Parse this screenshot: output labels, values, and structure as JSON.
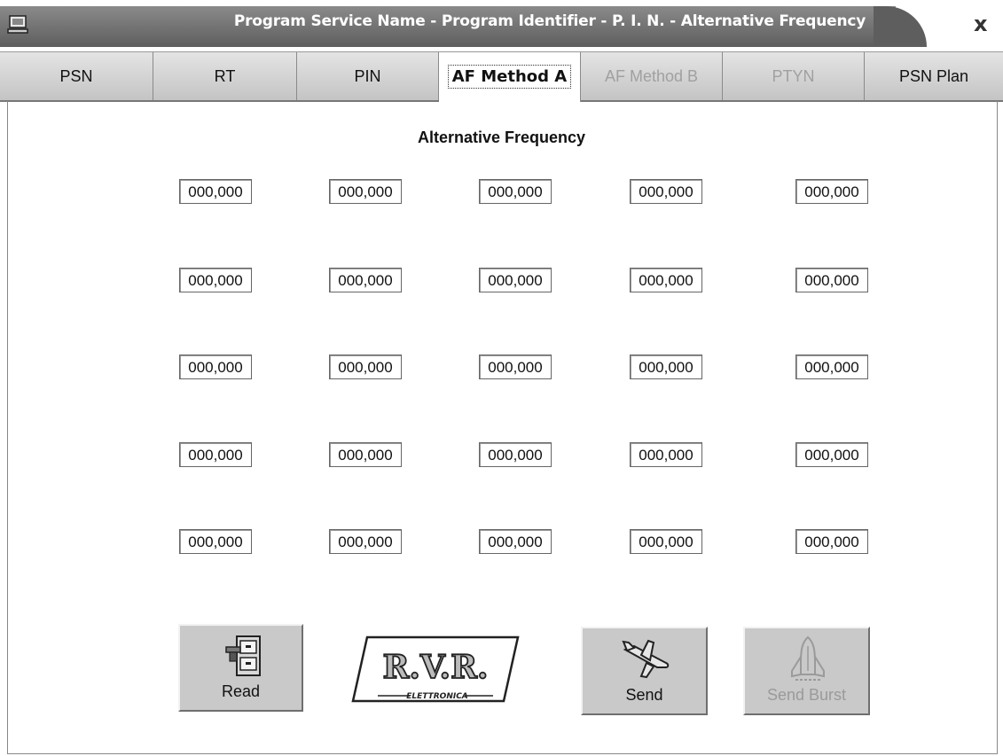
{
  "window": {
    "title": "Program Service Name - Program Identifier - P. I. N. - Alternative Frequency",
    "close_glyph": "x"
  },
  "tabs": [
    {
      "label": "PSN",
      "state": "normal"
    },
    {
      "label": "RT",
      "state": "normal"
    },
    {
      "label": "PIN",
      "state": "normal"
    },
    {
      "label": "AF Method A",
      "state": "active"
    },
    {
      "label": "AF Method B",
      "state": "disabled"
    },
    {
      "label": "PTYN",
      "state": "disabled"
    },
    {
      "label": "PSN Plan",
      "state": "normal"
    }
  ],
  "page": {
    "heading": "Alternative Frequency",
    "frequencies": [
      [
        "000,000",
        "000,000",
        "000,000",
        "000,000",
        "000,000"
      ],
      [
        "000,000",
        "000,000",
        "000,000",
        "000,000",
        "000,000"
      ],
      [
        "000,000",
        "000,000",
        "000,000",
        "000,000",
        "000,000"
      ],
      [
        "000,000",
        "000,000",
        "000,000",
        "000,000",
        "000,000"
      ],
      [
        "000,000",
        "000,000",
        "000,000",
        "000,000",
        "000,000"
      ]
    ]
  },
  "buttons": {
    "read_label": "Read",
    "send_label": "Send",
    "send_burst_label": "Send Burst"
  },
  "logo": {
    "text": "R.V.R.",
    "subtitle": "ELETTRONICA"
  },
  "colors": {
    "title_bar": "#5e5e5e",
    "tab_bar": "#c9c9c9",
    "disabled_text": "#a0a0a0"
  }
}
